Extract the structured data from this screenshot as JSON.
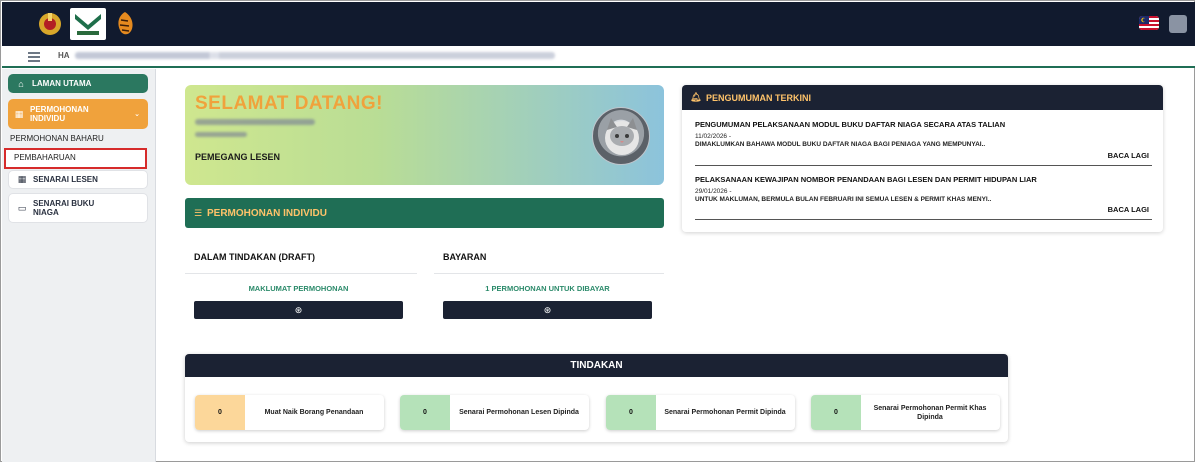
{
  "header": {
    "greeting_prefix": "HA",
    "logos": [
      "crest-logo",
      "agency-logo",
      "tiger-logo"
    ]
  },
  "sidebar": {
    "home_label": "LAMAN UTAMA",
    "permohonan_label_1": "PERMOHONAN",
    "permohonan_label_2": "INDIVIDU",
    "sub_items": [
      "PERMOHONAN BAHARU",
      "PEMBAHARUAN"
    ],
    "senarai_lesen": "SENARAI LESEN",
    "senarai_buku_1": "SENARAI BUKU",
    "senarai_buku_2": "NIAGA"
  },
  "welcome": {
    "title": "SELAMAT DATANG!",
    "role": "PEMEGANG LESEN"
  },
  "permohonan": {
    "header": "PERMOHONAN INDIVIDU",
    "draft_title": "DALAM TINDAKAN (DRAFT)",
    "draft_link": "MAKLUMAT PERMOHONAN",
    "bayaran_title": "BAYARAN",
    "bayaran_link": "1 PERMOHONAN UNTUK DIBAYAR"
  },
  "announcements": {
    "header": "PENGUMUMAN TERKINI",
    "items": [
      {
        "title": "PENGUMUMAN PELAKSANAAN MODUL BUKU DAFTAR NIAGA SECARA ATAS TALIAN",
        "date": "11/02/2026 -",
        "body": "DIMAKLUMKAN BAHAWA MODUL BUKU DAFTAR NIAGA BAGI PENIAGA YANG MEMPUNYAI..",
        "more": "BACA LAGI"
      },
      {
        "title": "PELAKSANAAN KEWAJIPAN NOMBOR PENANDAAN BAGI LESEN DAN PERMIT HIDUPAN LIAR",
        "date": "29/01/2026 -",
        "body": "UNTUK MAKLUMAN, BERMULA BULAN FEBRUARI INI SEMUA LESEN & PERMIT KHAS MENYI..",
        "more": "BACA LAGI"
      }
    ]
  },
  "tindakan": {
    "header": "TINDAKAN",
    "cards": [
      {
        "count": "0",
        "label": "Muat Naik Borang Penandaan",
        "color": "#fcd79a"
      },
      {
        "count": "0",
        "label": "Senarai Permohonan Lesen Dipinda",
        "color": "#b5e2b9"
      },
      {
        "count": "0",
        "label": "Senarai Permohonan Permit Dipinda",
        "color": "#b5e2b9"
      },
      {
        "count": "0",
        "label": "Senarai Permohonan Permit Khas Dipinda",
        "color": "#b5e2b9"
      }
    ]
  },
  "colors": {
    "dark_navy": "#111a2e",
    "green": "#1f6e55",
    "orange": "#f0a23c"
  }
}
